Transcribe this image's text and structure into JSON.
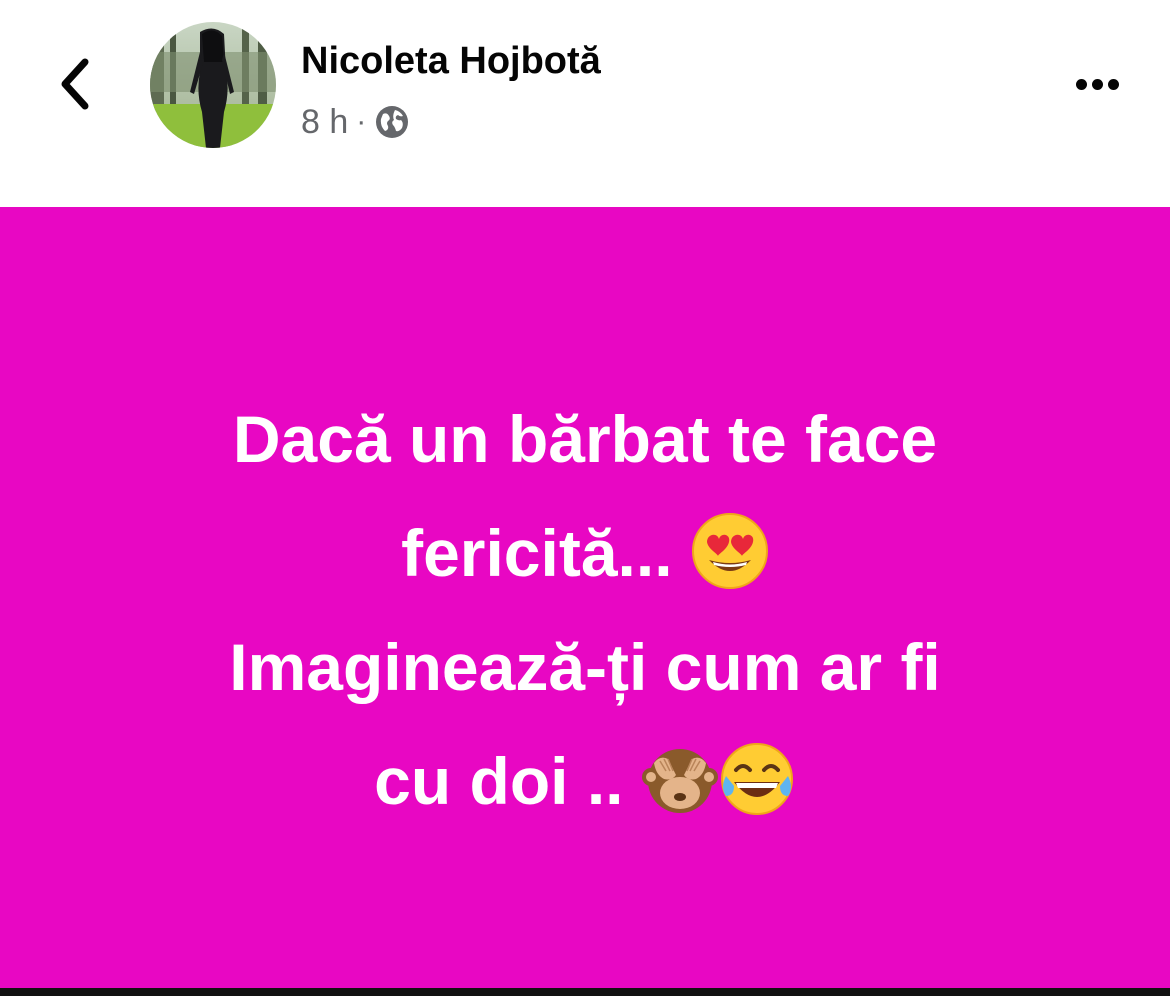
{
  "header": {
    "author_name": "Nicoleta Hojbotă",
    "time": "8 h",
    "separator": "·",
    "privacy_icon": "globe-icon",
    "back_icon": "chevron-left-icon",
    "more_icon": "more-horizontal-icon"
  },
  "post": {
    "background_color": "#e807c3",
    "text_color": "#ffffff",
    "lines": [
      "Dacă un bărbat te face",
      "fericită...",
      "Imaginează-ți cum ar fi",
      "cu doi .."
    ],
    "emojis": [
      "heart-eyes-emoji",
      "see-no-evil-monkey-emoji",
      "tears-of-joy-emoji"
    ]
  }
}
